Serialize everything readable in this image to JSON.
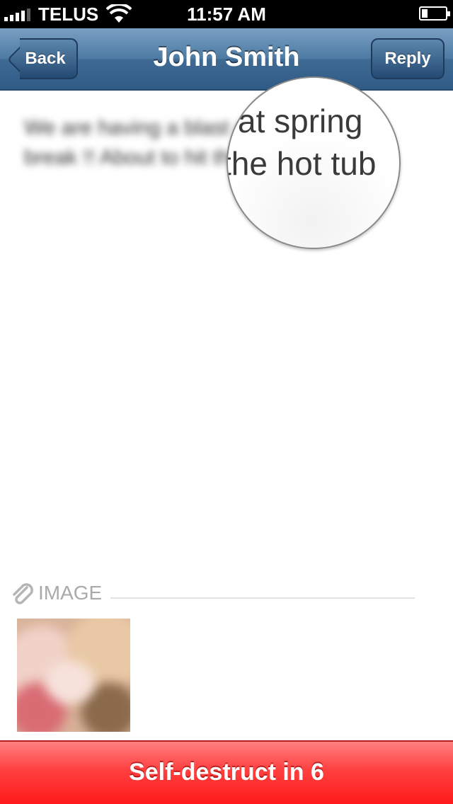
{
  "status_bar": {
    "carrier": "TELUS",
    "time": "11:57 AM",
    "signal_icon": "signal-bars-icon",
    "wifi_icon": "wifi-icon",
    "battery_icon": "battery-icon"
  },
  "nav": {
    "back_label": "Back",
    "title": "John Smith",
    "reply_label": "Reply"
  },
  "message": {
    "text": "We are having a blast at spring break !! About to hit the hot tub",
    "magnified_line_1": "at spring",
    "magnified_line_2": "the hot tub"
  },
  "attachment": {
    "icon": "paperclip-icon",
    "label": "IMAGE"
  },
  "footer": {
    "self_destruct_label": "Self-destruct in 6",
    "color": "#ff2a2a"
  },
  "colors": {
    "nav_bar": "#3e6a94",
    "self_destruct": "#ff2a2a"
  }
}
